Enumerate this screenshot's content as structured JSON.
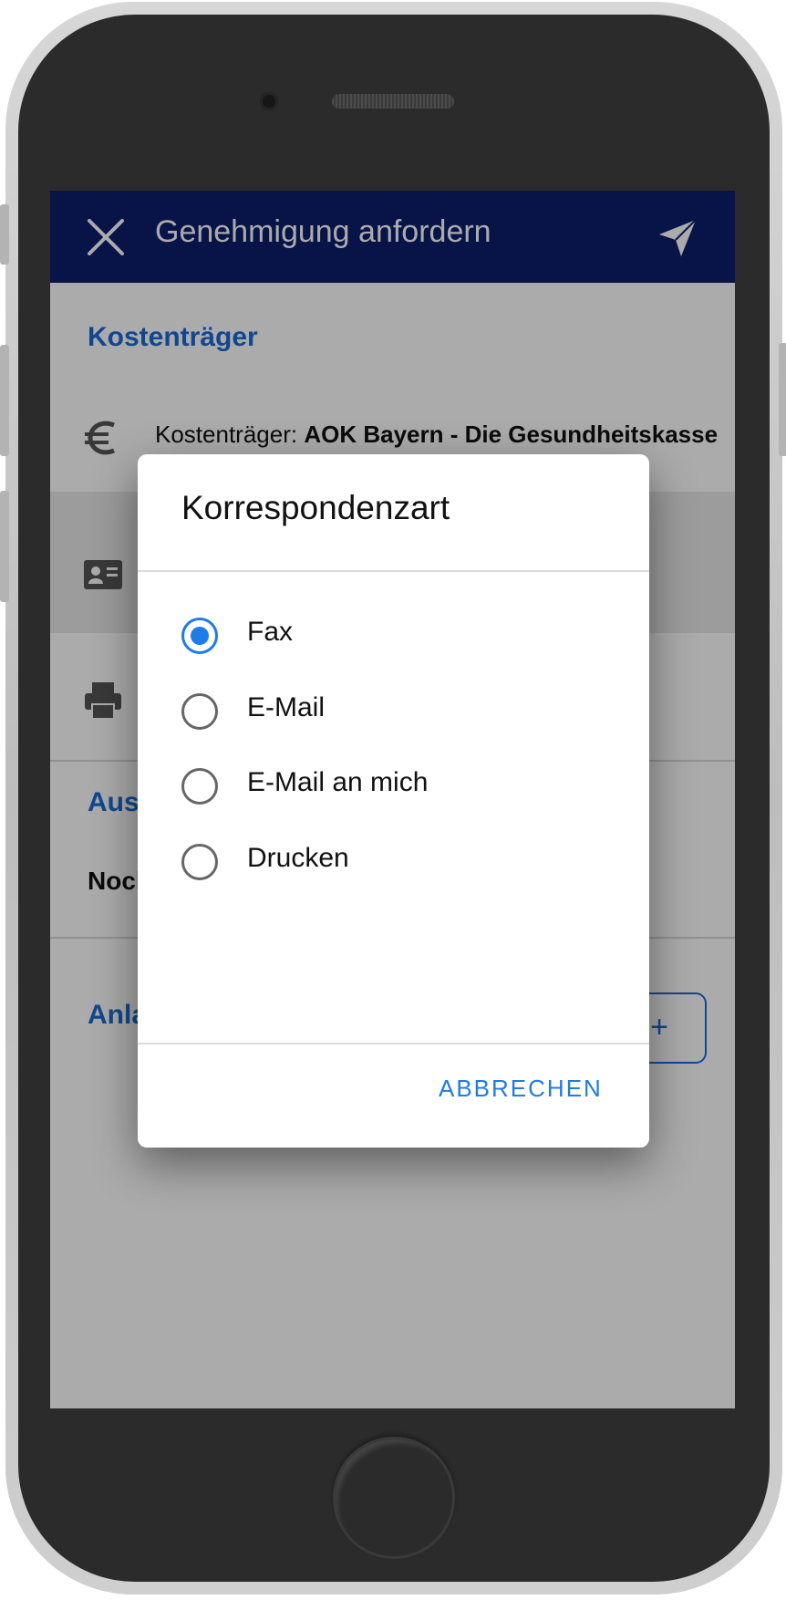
{
  "appbar": {
    "title": "Genehmigung anfordern",
    "close_icon": "close-icon",
    "send_icon": "send-icon",
    "color": "#0d1d6c"
  },
  "cost_section": {
    "title": "Kostenträger",
    "payer_label": "Kostenträger:",
    "payer_value": "AOK Bayern - Die Gesundheitskasse",
    "icons": [
      "euro-icon",
      "contact-card-icon",
      "printer-icon"
    ]
  },
  "issued_section": {
    "title_partial": "Ausg",
    "text_partial": "Noch"
  },
  "attachments_section": {
    "title_partial": "Anla",
    "add_button": "+"
  },
  "dialog": {
    "title": "Korrespondenzart",
    "options": [
      {
        "label": "Fax",
        "selected": true
      },
      {
        "label": "E-Mail",
        "selected": false
      },
      {
        "label": "E-Mail an mich",
        "selected": false
      },
      {
        "label": "Drucken",
        "selected": false
      }
    ],
    "cancel_label": "ABBRECHEN",
    "accent": "#1f7be6"
  }
}
